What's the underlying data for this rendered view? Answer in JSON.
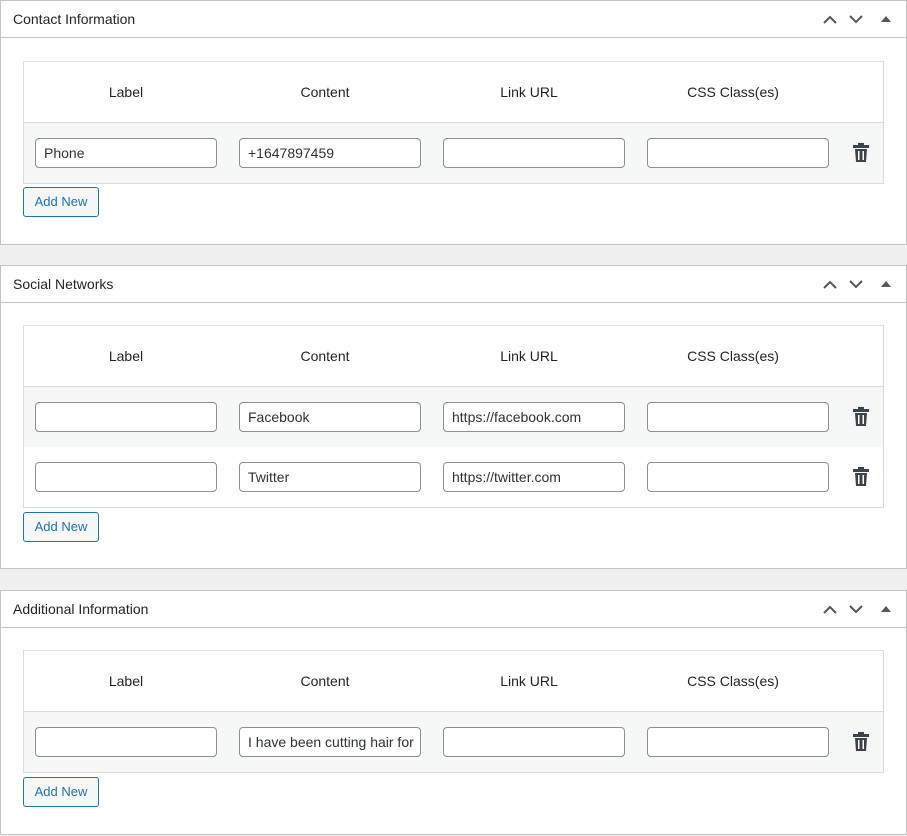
{
  "columns": [
    "Label",
    "Content",
    "Link URL",
    "CSS Class(es)"
  ],
  "add_new_label": "Add New",
  "colors": {
    "accent": "#2271b1",
    "border": "#c3c4c7",
    "background": "#f0f0f1"
  },
  "icons": {
    "move_up": "chevron-up-icon",
    "move_down": "chevron-down-icon",
    "toggle": "triangle-up-icon",
    "delete": "trash-icon"
  },
  "sections": [
    {
      "title": "Contact Information",
      "rows": [
        {
          "label": "Phone",
          "content": "+1647897459",
          "link_url": "",
          "css_class": ""
        }
      ]
    },
    {
      "title": "Social Networks",
      "rows": [
        {
          "label": "",
          "content": "Facebook",
          "link_url": "https://facebook.com",
          "css_class": ""
        },
        {
          "label": "",
          "content": "Twitter",
          "link_url": "https://twitter.com",
          "css_class": ""
        }
      ]
    },
    {
      "title": "Additional Information",
      "rows": [
        {
          "label": "",
          "content": "I have been cutting hair for",
          "link_url": "",
          "css_class": ""
        }
      ]
    }
  ]
}
